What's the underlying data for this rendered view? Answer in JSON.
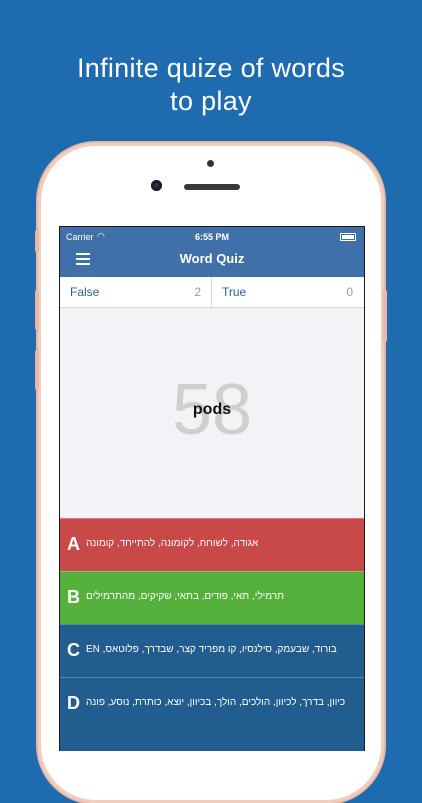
{
  "headline": {
    "line1": "Infinite quize of words",
    "line2": "to play"
  },
  "status_bar": {
    "carrier": "Carrier",
    "wifi_icon": "wifi-icon",
    "time": "6:55 PM",
    "battery_icon": "battery-icon"
  },
  "nav": {
    "menu_icon": "hamburger-menu-icon",
    "title": "Word Quiz"
  },
  "scores": {
    "false_label": "False",
    "false_value": "2",
    "true_label": "True",
    "true_value": "0"
  },
  "quiz": {
    "counter": "58",
    "word": "pods"
  },
  "answers": [
    {
      "letter": "A",
      "text": "אגודה, לשוחח, לקומונה, להתייחד, קומונה",
      "color": "#c94848"
    },
    {
      "letter": "B",
      "text": "תרמילי, תאי, פודים, בתאי, שקיקים, מהתרמילים",
      "color": "#56b13c"
    },
    {
      "letter": "C",
      "text": "בורוד, שבעמק, סילנסיו, קו מפריד קצר, שבדרך, פלוטאס, EN",
      "color": "#215d8f"
    },
    {
      "letter": "D",
      "text": "כיוון, בדרך, לכיוון, הולכים, הולך, בכיוון, יוצא, כותרת, נוסע, פונה",
      "color": "#215d8f"
    }
  ],
  "colors": {
    "background": "#1f6bb0",
    "navbar": "#3f70a8",
    "phone_frame": "#f2cdbd"
  }
}
